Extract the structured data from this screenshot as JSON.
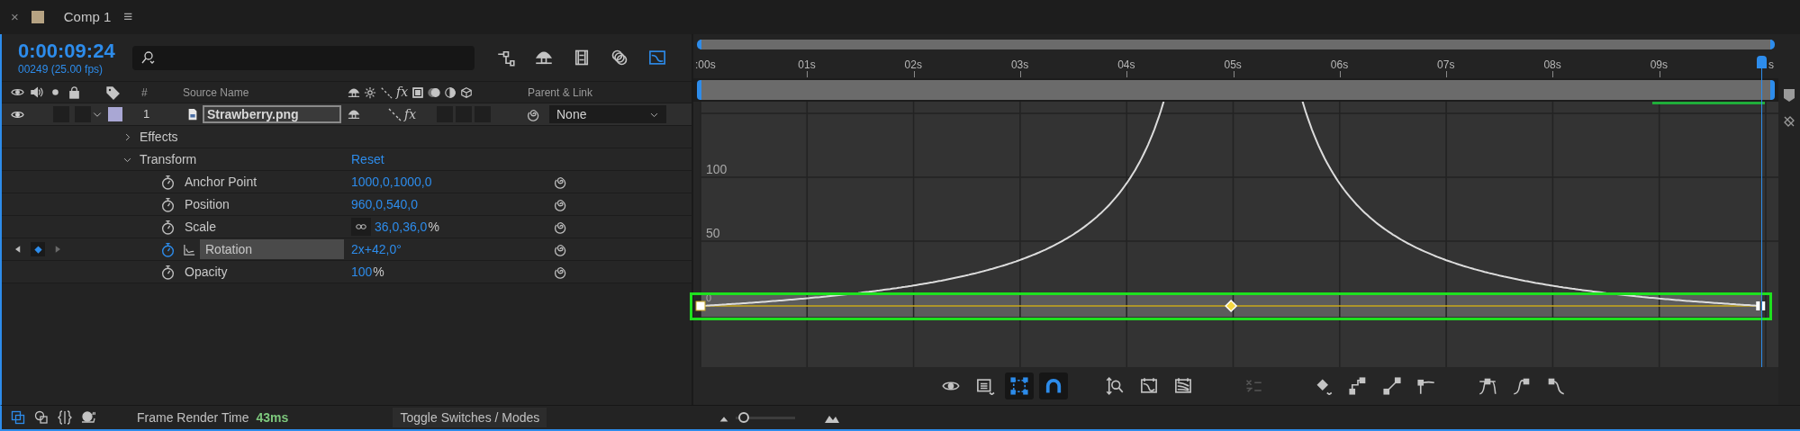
{
  "tab": {
    "close": "×",
    "title": "Comp 1",
    "menu": "≡"
  },
  "timecode": "0:00:09:24",
  "frame_info": "00249 (25.00 fps)",
  "panel_tools": [
    {
      "kind": "flowchart",
      "on": false
    },
    {
      "kind": "shy",
      "on": false
    },
    {
      "kind": "film",
      "on": false
    },
    {
      "kind": "circles",
      "on": false
    },
    {
      "kind": "graph",
      "on": true
    }
  ],
  "columns": {
    "number": "#",
    "source": "Source Name",
    "fx": "fx",
    "parent": "Parent & Link"
  },
  "layer": {
    "number": "1",
    "name": "Strawberry.png",
    "fx": "fx",
    "parent": "None",
    "expanded": true
  },
  "properties": [
    {
      "kind": "group",
      "name": "Effects",
      "expanded": false
    },
    {
      "kind": "group",
      "name": "Transform",
      "expanded": true,
      "action": "Reset"
    },
    {
      "kind": "property",
      "name": "Anchor Point",
      "value": "1000,0,1000,0",
      "animated": false,
      "selected": false
    },
    {
      "kind": "property",
      "name": "Position",
      "value": "960,0,540,0",
      "animated": false,
      "selected": false
    },
    {
      "kind": "property",
      "name": "Scale",
      "value": "36,0,36,0",
      "unit": "%",
      "linked": true,
      "animated": false,
      "selected": false
    },
    {
      "kind": "property",
      "name": "Rotation",
      "value": "2x+42,0°",
      "animated": true,
      "selected": true
    },
    {
      "kind": "property",
      "name": "Opacity",
      "value": "100",
      "unit": "%",
      "animated": false,
      "selected": false
    }
  ],
  "ruler": [
    ":00s",
    "01s",
    "02s",
    "03s",
    "04s",
    "05s",
    "06s",
    "07s",
    "08s",
    "09s",
    "s"
  ],
  "playhead": {
    "level": 0.996
  },
  "graph": {
    "y_labels": [
      "100",
      "50",
      "0"
    ]
  },
  "graph_tools": [
    {
      "kind": "eye",
      "on": false,
      "disabled": false
    },
    {
      "kind": "list",
      "on": false,
      "disabled": false
    },
    {
      "kind": "frame",
      "on": true,
      "disabled": false
    },
    {
      "kind": "magnet",
      "on": true,
      "disabled": false
    },
    {
      "kind": "zoom",
      "on": false,
      "disabled": false
    },
    {
      "kind": "fit",
      "on": false,
      "disabled": false
    },
    {
      "kind": "fitall",
      "on": false,
      "disabled": false
    },
    {
      "kind": "separate",
      "on": false,
      "disabled": true
    },
    {
      "kind": "diamond",
      "on": false,
      "disabled": false
    },
    {
      "kind": "hold",
      "on": false,
      "disabled": false
    },
    {
      "kind": "linear",
      "on": false,
      "disabled": false
    },
    {
      "kind": "auto",
      "on": false,
      "disabled": false
    },
    {
      "kind": "easy",
      "on": false,
      "disabled": false
    },
    {
      "kind": "easein",
      "on": false,
      "disabled": false
    },
    {
      "kind": "easeout",
      "on": false,
      "disabled": false
    }
  ],
  "status_tools": [
    {
      "kind": "comp",
      "on": true
    },
    {
      "kind": "shapes",
      "on": false
    },
    {
      "kind": "braces",
      "on": false
    },
    {
      "kind": "snail",
      "on": false
    }
  ],
  "status": {
    "label": "Frame Render Time",
    "value": "43ms",
    "toggle": "Toggle Switches / Modes"
  },
  "zoom": {
    "level": 0.05
  }
}
